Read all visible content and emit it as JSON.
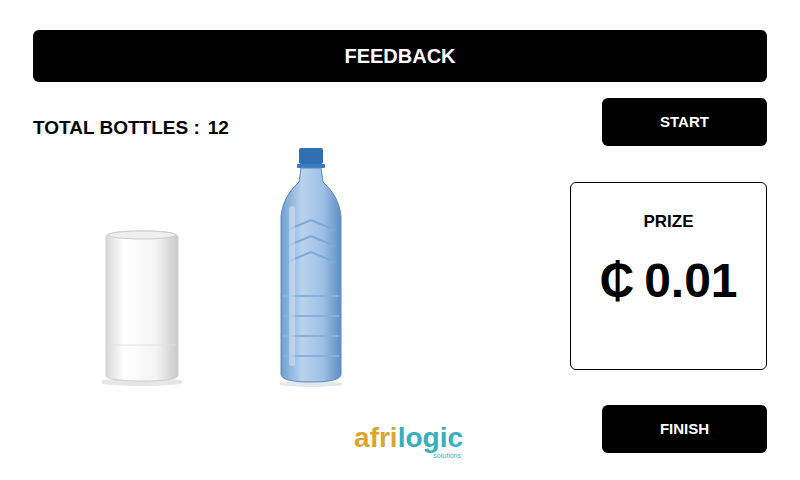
{
  "header": {
    "title": "FEEDBACK"
  },
  "counter": {
    "label": "TOTAL BOTTLES :",
    "count": "12"
  },
  "buttons": {
    "start": "START",
    "finish": "FINISH"
  },
  "prize": {
    "title": "PRIZE",
    "currency": "₵",
    "amount": "0.01"
  },
  "logo": {
    "parts": [
      {
        "text": "afri",
        "color": "#d9a62a"
      },
      {
        "text": "logic",
        "color": "#36b0bd"
      }
    ],
    "tagline": "solutions"
  }
}
